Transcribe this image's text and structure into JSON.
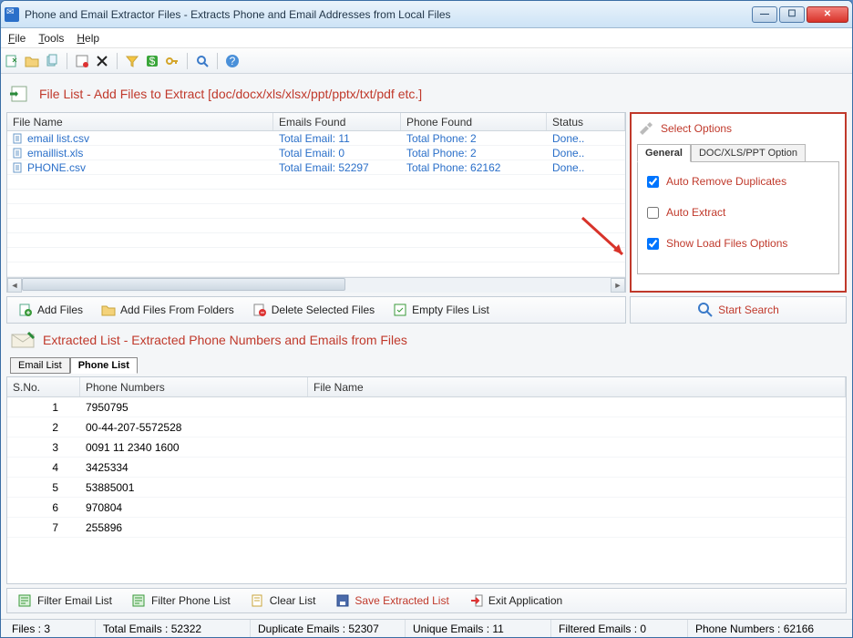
{
  "window": {
    "title": "Phone and Email Extractor Files  -  Extracts Phone and Email Addresses from Local Files"
  },
  "menu": {
    "file": "File",
    "tools": "Tools",
    "help": "Help"
  },
  "file_list": {
    "title": "File List - Add Files to Extract  [doc/docx/xls/xlsx/ppt/pptx/txt/pdf etc.]",
    "cols": {
      "fn": "File Name",
      "em": "Emails Found",
      "ph": "Phone Found",
      "st": "Status"
    },
    "rows": [
      {
        "fn": "email list.csv",
        "em": "Total Email: 11",
        "ph": "Total Phone: 2",
        "st": "Done.."
      },
      {
        "fn": "emaillist.xls",
        "em": "Total Email: 0",
        "ph": "Total Phone: 2",
        "st": "Done.."
      },
      {
        "fn": "PHONE.csv",
        "em": "Total Email: 52297",
        "ph": "Total Phone: 62162",
        "st": "Done.."
      }
    ]
  },
  "options": {
    "title": "Select Options",
    "tabs": {
      "general": "General",
      "doc": "DOC/XLS/PPT Option"
    },
    "auto_remove": "Auto Remove Duplicates",
    "auto_extract": "Auto Extract",
    "show_load": "Show Load Files Options"
  },
  "actions": {
    "add_files": "Add Files",
    "add_folders": "Add Files From Folders",
    "delete_selected": "Delete Selected Files",
    "empty_list": "Empty Files List",
    "start_search": "Start Search"
  },
  "extracted": {
    "title": "Extracted List - Extracted Phone Numbers and Emails from Files",
    "tabs": {
      "email": "Email List",
      "phone": "Phone List"
    },
    "cols": {
      "sno": "S.No.",
      "phone": "Phone Numbers",
      "fn": "File Name"
    },
    "rows": [
      {
        "sno": "1",
        "phone": "7950795",
        "fn": ""
      },
      {
        "sno": "2",
        "phone": "00-44-207-5572528",
        "fn": ""
      },
      {
        "sno": "3",
        "phone": "0091 11 2340 1600",
        "fn": ""
      },
      {
        "sno": "4",
        "phone": "3425334",
        "fn": ""
      },
      {
        "sno": "5",
        "phone": "53885001",
        "fn": ""
      },
      {
        "sno": "6",
        "phone": "970804",
        "fn": ""
      },
      {
        "sno": "7",
        "phone": "255896",
        "fn": ""
      }
    ]
  },
  "bottom": {
    "filter_email": "Filter Email List",
    "filter_phone": "Filter Phone List",
    "clear_list": "Clear List",
    "save_list": "Save Extracted List",
    "exit_app": "Exit Application"
  },
  "status": {
    "files": "Files :  3",
    "total": "Total Emails :  52322",
    "dup": "Duplicate Emails :  52307",
    "uniq": "Unique Emails :  11",
    "filt": "Filtered Emails :  0",
    "phones": "Phone Numbers :  62166"
  }
}
